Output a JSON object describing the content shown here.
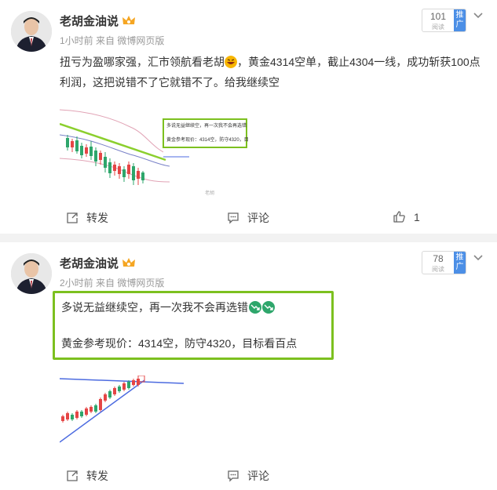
{
  "posts": [
    {
      "username": "老胡金油说",
      "meta": "1小时前  来自 微博网页版",
      "views_count": "101",
      "views_label": "阅读",
      "promote_label": "推广",
      "content_before_emoji": "扭亏为盈哪家强，汇市领航看老胡",
      "content_after_emoji": "，黄金4314空单，截止4304一线，成功斩获100点利润，这把说错不了它就错不了。给我继续空",
      "thumbnail": {
        "line1": "多说无益继续空，再一次我不会再选错",
        "line2": "黄金参考现价：4314空，防守4320，目标看百点",
        "watermark": "老胡"
      },
      "actions": {
        "repost": "转发",
        "comment": "评论",
        "like_count": "1"
      }
    },
    {
      "username": "老胡金油说",
      "meta": "2小时前  来自 微博网页版",
      "views_count": "78",
      "views_label": "阅读",
      "promote_label": "推广",
      "quote_line1": "多说无益继续空，再一次我不会再选错",
      "quote_line2": "黄金参考现价：4314空，防守4320，目标看百点",
      "actions": {
        "repost": "转发",
        "comment": "评论"
      }
    }
  ],
  "colors": {
    "accent_green": "#7cc01f",
    "promote_blue": "#4c8fe6",
    "bull": "#e54545",
    "bear": "#2ea66b"
  },
  "icons": [
    "vip-crown-icon",
    "chevron-down-icon",
    "repost-icon",
    "comment-icon",
    "like-icon",
    "laugh-emoji-icon",
    "trend-down-icon"
  ]
}
